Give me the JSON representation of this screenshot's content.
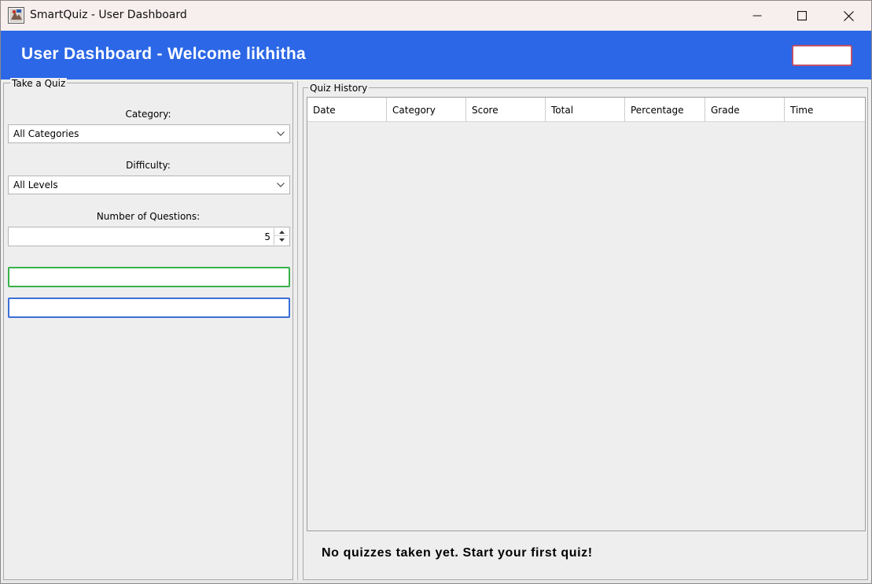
{
  "window": {
    "title": "SmartQuiz - User Dashboard",
    "icons": {
      "app": "java-app-icon",
      "minimize": "minimize-icon",
      "maximize": "maximize-icon",
      "close": "close-icon"
    }
  },
  "header": {
    "title": "User Dashboard - Welcome likhitha",
    "logout_label": "",
    "background_color": "#2b67e6",
    "logout_border_color": "#c0506a"
  },
  "take_quiz": {
    "panel_title": "Take a Quiz",
    "category_label": "Category:",
    "category_selected": "All Categories",
    "difficulty_label": "Difficulty:",
    "difficulty_selected": "All Levels",
    "num_questions_label": "Number of Questions:",
    "num_questions_value": "5",
    "start_button_label": "",
    "start_button_color": "#38b24a",
    "second_button_label": "",
    "second_button_color": "#3b6fd8"
  },
  "quiz_history": {
    "panel_title": "Quiz History",
    "columns": [
      "Date",
      "Category",
      "Score",
      "Total",
      "Percentage",
      "Grade",
      "Time"
    ],
    "rows": [],
    "empty_message": "No quizzes taken yet. Start your first quiz!"
  }
}
